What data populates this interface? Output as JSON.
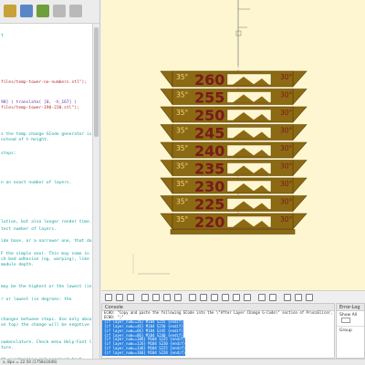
{
  "editor": {
    "lines": [
      {
        "text": "t",
        "cls": ""
      },
      {
        "text": "files/temp-tower-no-numbers.stl\");",
        "cls": "s"
      },
      {
        "text": "90] ) translate( [0, -h_167] )",
        "cls": "k"
      },
      {
        "text": "files/temp-tower-190-230.stl\");",
        "cls": "s"
      },
      {
        "text": "s the temp change GCode generator is",
        "cls": ""
      },
      {
        "text": "nstead of t-height.",
        "cls": ""
      },
      {
        "text": "steps:",
        "cls": ""
      },
      {
        "text": "n an exact number of layers.",
        "cls": ""
      },
      {
        "text": "lution, but also longer render time.",
        "cls": ""
      },
      {
        "text": "tect number of layers.",
        "cls": ""
      },
      {
        "text": "ide base, or a narrower one, that does",
        "cls": ""
      },
      {
        "text": "F the simple one). This may come in",
        "cls": ""
      },
      {
        "text": "ch bed adhesion (eg. warping), like",
        "cls": ""
      },
      {
        "text": "module depth.",
        "cls": ""
      },
      {
        "text": "may be the highest or the lowest (in",
        "cls": ""
      },
      {
        "text": "r or lowest (in degrees: the",
        "cls": ""
      },
      {
        "text": "changes between steps. Use only absolute",
        "cls": ""
      },
      {
        "text": "on top) the change will be negative",
        "cls": ""
      },
      {
        "text": "nomenclature. Check menu Help-Font list",
        "cls": ""
      },
      {
        "text": "ture.",
        "cls": ""
      },
      {
        "text": "th overhanging and engraved text.",
        "cls": ""
      }
    ]
  },
  "tower": {
    "temps": [
      "260",
      "255",
      "250",
      "245",
      "240",
      "235",
      "230",
      "225",
      "220"
    ],
    "left_angle": "35°",
    "right_angle": "30°",
    "colors": {
      "body": "#8c6a14",
      "edge": "#5a4208",
      "text": "#7a1a1a",
      "label": "#f2d98a",
      "background": "#fdf6d0"
    }
  },
  "console": {
    "title": "Console",
    "lines": [
      {
        "text": "ECHO: \"Copy and paste the following GCode into the \\\"After Layer Change G-Code\\\" section of PrusaSlicer, minus the \\\"ECHO: \\\" lines\"",
        "sel": false
      },
      {
        "text": "ECHO: \";\"",
        "sel": false
      },
      {
        "text": "{if layer_num==26} M104 S255 {endif}",
        "sel": true
      },
      {
        "text": "{if layer_num==46} M104 S250 {endif}",
        "sel": true
      },
      {
        "text": "{if layer_num==66} M104 S245 {endif}",
        "sel": true
      },
      {
        "text": "{if layer_num==86} M104 S240 {endif}",
        "sel": true
      },
      {
        "text": "{if layer_num==106} M104 S235 {endif}",
        "sel": true
      },
      {
        "text": "{if layer_num==126} M104 S230 {endif}",
        "sel": true
      },
      {
        "text": "{if layer_num==146} M104 S225 {endif}",
        "sel": true
      },
      {
        "text": "{if layer_num==166} M104 S220 {endif}",
        "sel": true
      }
    ]
  },
  "errorlog": {
    "title": "Error-Log",
    "show_label": "Show",
    "show_value": "All",
    "group_label": "Group"
  },
  "statusbar": {
    "text": "x, 8px = 22.50 (1758x1646)"
  }
}
